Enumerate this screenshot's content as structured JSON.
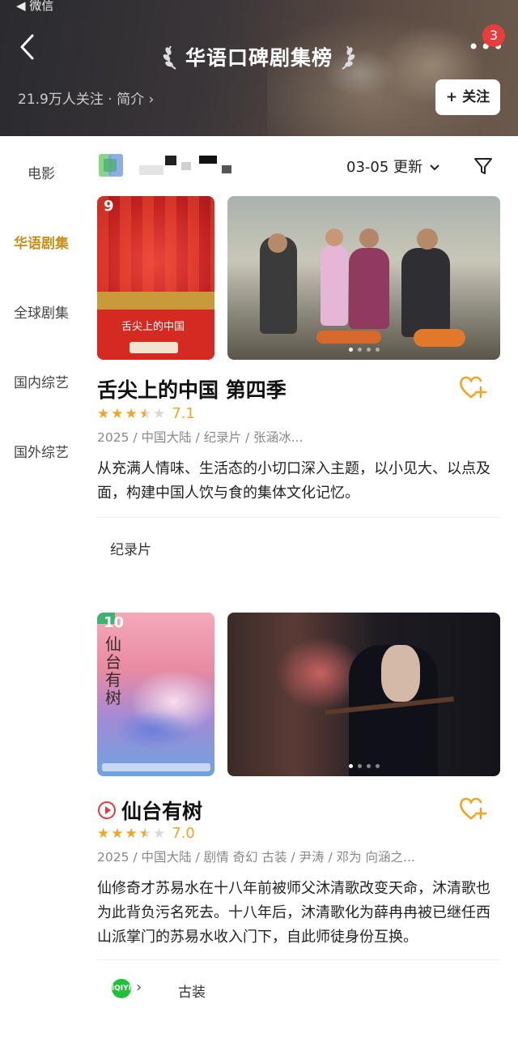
{
  "status_bar": {
    "back_label": "◀ 微信"
  },
  "header": {
    "title": "华语口碑剧集榜",
    "follow_info": "21.9万人关注 · 简介 ›",
    "follow_button": "+ 关注",
    "notification_count": "3",
    "more_label": "•••"
  },
  "sidebar": {
    "items": [
      {
        "label": "电影",
        "active": false
      },
      {
        "label": "华语剧集",
        "active": true
      },
      {
        "label": "全球剧集",
        "active": false
      },
      {
        "label": "国内综艺",
        "active": false
      },
      {
        "label": "国外综艺",
        "active": false
      }
    ]
  },
  "filter_bar": {
    "update_label": "03-05 更新"
  },
  "shows": [
    {
      "rank": "9",
      "title": "舌尖上的中国 第四季",
      "rating": "7.1",
      "rating_stars": 3.5,
      "meta": "2025 / 中国大陆 / 纪录片 / 张涵冰...",
      "description": "从充满人情味、生活态的小切口深入主题，以小见大、以点及面，构建中国人饮与食的集体文化记忆。",
      "tag": "纪录片"
    },
    {
      "rank": "10",
      "title": "仙台有树",
      "rating": "7.0",
      "rating_stars": 3.5,
      "meta": "2025 / 中国大陆 / 剧情 奇幻 古装 / 尹涛 / 邓为 向涵之...",
      "description": "仙修奇才苏易水在十八年前被师父沐清歌改变天命，沐清歌也为此背负污名死去。十八年后，沐清歌化为薛冉冉被已继任西山派掌门的苏易水收入门下，自此师徒身份互换。",
      "platform": "iQIYI",
      "tag": "古装"
    }
  ],
  "colors": {
    "accent": "#c8901a",
    "star": "#f0a526",
    "badge": "#e83d3d",
    "iqiyi": "#1fc138"
  }
}
